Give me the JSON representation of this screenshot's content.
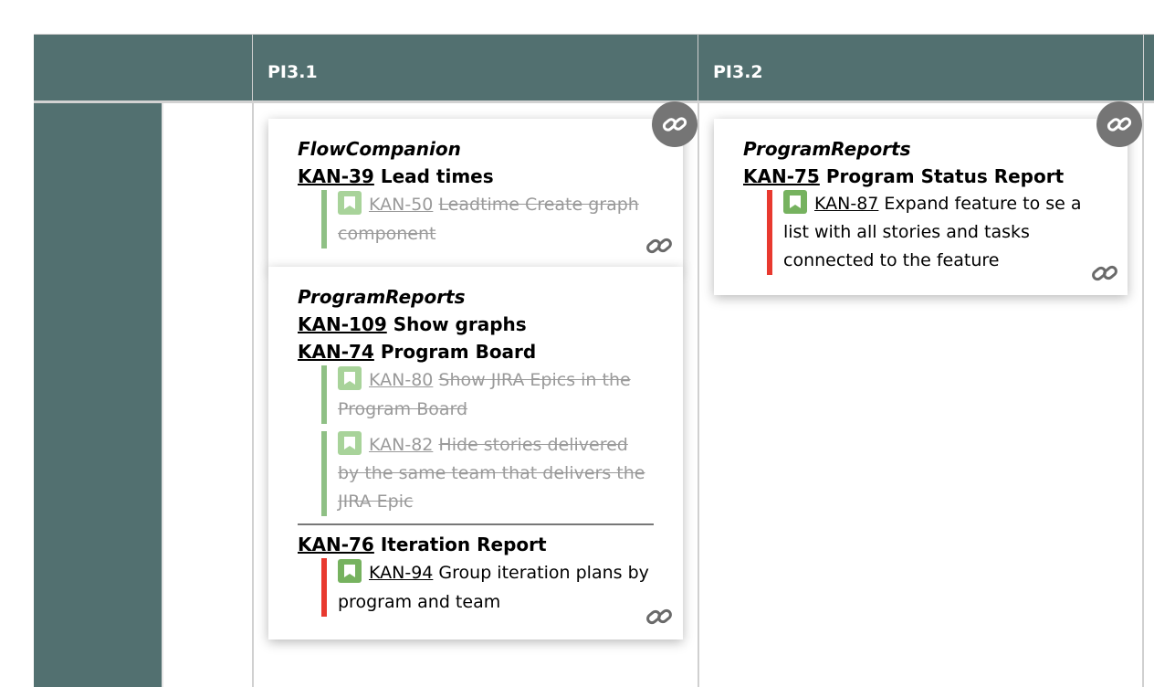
{
  "board": {
    "columns": [
      {
        "label": "PI3.1"
      },
      {
        "label": "PI3.2"
      }
    ]
  },
  "cards": [
    {
      "project": "FlowCompanion",
      "features": [
        {
          "key": "KAN-39",
          "title": "Lead times",
          "stories": [
            {
              "key": "KAN-50",
              "summary": "Leadtime Create graph component",
              "status": "done"
            }
          ]
        }
      ]
    },
    {
      "project": "ProgramReports",
      "features": [
        {
          "key": "KAN-109",
          "title": "Show graphs",
          "stories": []
        },
        {
          "key": "KAN-74",
          "title": "Program Board",
          "stories": [
            {
              "key": "KAN-80",
              "summary": "Show JIRA Epics in the Program Board",
              "status": "done"
            },
            {
              "key": "KAN-82",
              "summary": "Hide stories delivered by the same team that delivers the JIRA Epic",
              "status": "done"
            }
          ]
        },
        {
          "key": "KAN-76",
          "title": "Iteration Report",
          "stories": [
            {
              "key": "KAN-94",
              "summary": "Group iteration plans by program and team",
              "status": "open"
            }
          ]
        }
      ]
    },
    {
      "project": "ProgramReports",
      "features": [
        {
          "key": "KAN-75",
          "title": "Program Status Report",
          "stories": [
            {
              "key": "KAN-87",
              "summary": "Expand feature to se a list with all stories and tasks connected to the feature",
              "status": "open"
            }
          ]
        }
      ]
    }
  ],
  "icons": {
    "dependency_badge": "link-icon",
    "story_type": "bookmark-icon"
  },
  "colors": {
    "header_bg": "#527070",
    "story_done_bar": "#8fc085",
    "story_open_bar": "#e8392f",
    "story_icon": "#76b25f",
    "link_badge": "#757575"
  }
}
